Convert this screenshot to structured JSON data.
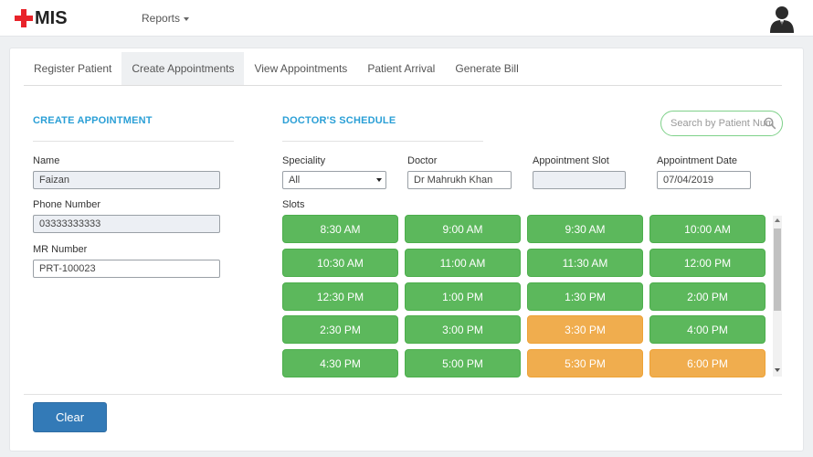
{
  "app": {
    "logo": "MIS"
  },
  "nav": {
    "reports_label": "Reports"
  },
  "tabs": [
    {
      "label": "Register Patient"
    },
    {
      "label": "Create Appointments"
    },
    {
      "label": "View Appointments"
    },
    {
      "label": "Patient Arrival"
    },
    {
      "label": "Generate Bill"
    }
  ],
  "create_appointment": {
    "title": "CREATE APPOINTMENT",
    "name_label": "Name",
    "name_value": "Faizan",
    "phone_label": "Phone Number",
    "phone_value": "03333333333",
    "mr_label": "MR Number",
    "mr_value": "PRT-100023"
  },
  "doctor_schedule": {
    "title": "DOCTOR'S SCHEDULE",
    "speciality_label": "Speciality",
    "speciality_value": "All",
    "doctor_label": "Doctor",
    "doctor_value": "Dr Mahrukh Khan",
    "slot_label": "Appointment Slot",
    "slot_value": "",
    "date_label": "Appointment Date",
    "date_value": "07/04/2019",
    "slots_label": "Slots"
  },
  "search": {
    "placeholder": "Search by Patient Num"
  },
  "slots": [
    {
      "time": "8:30 AM",
      "status": "available"
    },
    {
      "time": "9:00 AM",
      "status": "available"
    },
    {
      "time": "9:30 AM",
      "status": "available"
    },
    {
      "time": "10:00 AM",
      "status": "available"
    },
    {
      "time": "10:30 AM",
      "status": "available"
    },
    {
      "time": "11:00 AM",
      "status": "available"
    },
    {
      "time": "11:30 AM",
      "status": "available"
    },
    {
      "time": "12:00 PM",
      "status": "available"
    },
    {
      "time": "12:30 PM",
      "status": "available"
    },
    {
      "time": "1:00 PM",
      "status": "available"
    },
    {
      "time": "1:30 PM",
      "status": "available"
    },
    {
      "time": "2:00 PM",
      "status": "available"
    },
    {
      "time": "2:30 PM",
      "status": "available"
    },
    {
      "time": "3:00 PM",
      "status": "available"
    },
    {
      "time": "3:30 PM",
      "status": "booked"
    },
    {
      "time": "4:00 PM",
      "status": "available"
    },
    {
      "time": "4:30 PM",
      "status": "available"
    },
    {
      "time": "5:00 PM",
      "status": "available"
    },
    {
      "time": "5:30 PM",
      "status": "booked"
    },
    {
      "time": "6:00 PM",
      "status": "booked"
    }
  ],
  "colors": {
    "available": "#5cb85c",
    "booked": "#f0ad4e",
    "accent": "#2a9fd6",
    "primary_button": "#337ab7"
  },
  "actions": {
    "clear_label": "Clear"
  }
}
